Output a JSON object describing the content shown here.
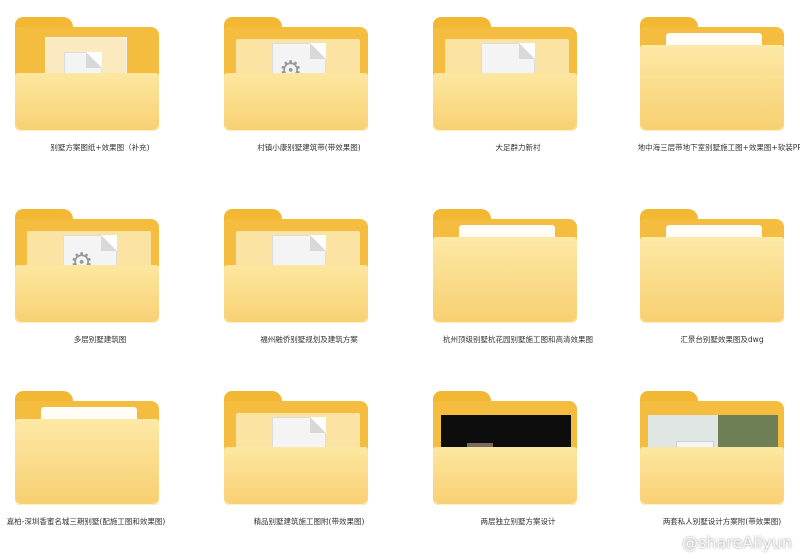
{
  "folders": [
    {
      "name": "别墅方案图纸+效果图（补充)",
      "preview": "document"
    },
    {
      "name": "村镇小康别墅建筑带(带效果图)",
      "preview": "settings-file"
    },
    {
      "name": "大足群力新村",
      "preview": "document"
    },
    {
      "name": "地中海三层带地下室别墅施工图+效果图+软装PPT",
      "preview": "empty"
    },
    {
      "name": "多层别墅建筑图",
      "preview": "settings-file"
    },
    {
      "name": "福州融侨别墅规划及建筑方案",
      "preview": "document"
    },
    {
      "name": "杭州顶级别墅杭花园别墅施工图和高清效果图",
      "preview": "empty"
    },
    {
      "name": "汇景台别墅效果图及dwg",
      "preview": "empty"
    },
    {
      "name": "嘉柏-深圳香蜜名城三期别墅(配施工图和效果图)",
      "preview": "empty"
    },
    {
      "name": "精品别墅建筑施工图附(带效果图)",
      "preview": "document"
    },
    {
      "name": "两层独立别墅方案设计",
      "preview": "photo-dark"
    },
    {
      "name": "两套私人别墅设计方案附(带效果图)",
      "preview": "photo-light"
    }
  ],
  "watermark": "@shareAliyun"
}
